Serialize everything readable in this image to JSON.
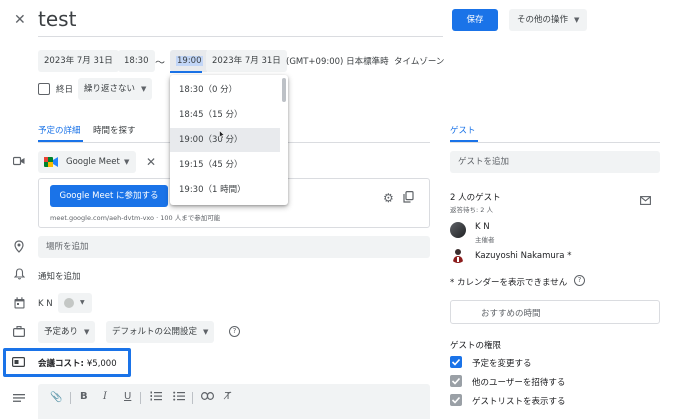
{
  "header": {
    "close_icon": "close-icon",
    "title": "test",
    "save_label": "保存",
    "more_actions_label": "その他の操作"
  },
  "datetime": {
    "start_date": "2023年 7月 31日",
    "start_time": "18:30",
    "separator": "〜",
    "end_time": "19:00",
    "end_date": "2023年 7月 31日",
    "timezone": "(GMT+09:00) 日本標準時",
    "timezone_link": "タイムゾーン",
    "allday_label": "終日",
    "repeat_label": "繰り返さない"
  },
  "time_dropdown": {
    "options": [
      {
        "label": "18:30（0 分）"
      },
      {
        "label": "18:45（15 分）"
      },
      {
        "label": "19:00（30 分）"
      },
      {
        "label": "19:15（45 分）"
      },
      {
        "label": "19:30（1 時間）"
      }
    ],
    "selected_index": 2
  },
  "tabs": {
    "details": "予定の詳細",
    "find_time": "時間を探す",
    "guests": "ゲスト"
  },
  "meet": {
    "label": "Google Meet",
    "join_button": "Google Meet に参加する",
    "link_text": "meet.google.com/aeh-dvtm-vxo · 100 人まで参加可能"
  },
  "fields": {
    "location_placeholder": "場所を追加",
    "notification": "通知を追加",
    "calendar_owner": "K N",
    "availability": "予定あり",
    "visibility": "デフォルトの公開設定",
    "meeting_cost_label": "会議コスト:",
    "meeting_cost_value": "¥5,000"
  },
  "guests": {
    "add_placeholder": "ゲストを追加",
    "count_label": "2 人のゲスト",
    "pending_label": "返答待ち: 2 人",
    "list": [
      {
        "name": "K N",
        "role": "主催者"
      },
      {
        "name": "Kazuyoshi Nakamura *",
        "role": ""
      }
    ],
    "calendar_warning": "* カレンダーを表示できません",
    "suggested_times": "おすすめの時間",
    "permissions_title": "ゲストの権限",
    "permissions": [
      {
        "label": "予定を変更する",
        "checked": true,
        "disabled": false
      },
      {
        "label": "他のユーザーを招待する",
        "checked": true,
        "disabled": true
      },
      {
        "label": "ゲストリストを表示する",
        "checked": true,
        "disabled": true
      }
    ]
  },
  "colors": {
    "accent": "#1a73e8",
    "highlight_box": "#1a73e8"
  }
}
